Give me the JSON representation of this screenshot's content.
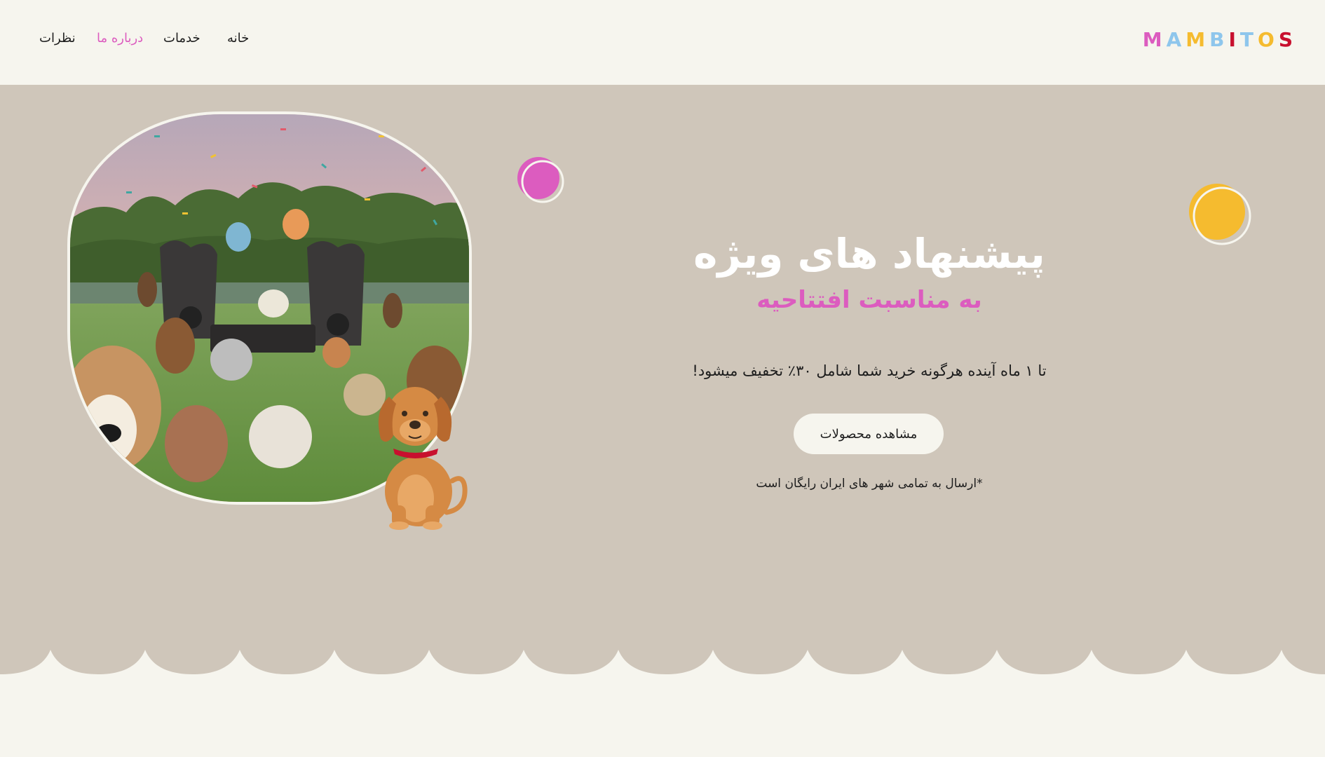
{
  "nav": {
    "items": [
      {
        "label": "نظرات",
        "active": false
      },
      {
        "label": "درباره ما",
        "active": true
      },
      {
        "label": "خدمات",
        "active": false
      },
      {
        "label": "خانه",
        "active": false
      }
    ]
  },
  "logo": {
    "letters": [
      {
        "char": "M",
        "color": "#dc5cbf"
      },
      {
        "char": "A",
        "color": "#8ec6ec"
      },
      {
        "char": "M",
        "color": "#f5bb2f"
      },
      {
        "char": "B",
        "color": "#8ec6ec"
      },
      {
        "char": "I",
        "color": "#c8102e"
      },
      {
        "char": "T",
        "color": "#8ec6ec"
      },
      {
        "char": "O",
        "color": "#f5bb2f"
      },
      {
        "char": "S",
        "color": "#c8102e"
      }
    ]
  },
  "hero": {
    "title": "پیشنهاد های ویژه",
    "subtitle": "به مناسبت افتتاحیه",
    "description": "تا ۱ ماه آینده هرگونه خرید شما شامل ۳۰٪ تخفیف میشود!",
    "cta_label": "مشاهده محصولات",
    "note": "*ارسال به تمامی شهر های ایران رایگان است"
  },
  "colors": {
    "background": "#f6f5ee",
    "hero_background": "#cfc6ba",
    "accent_pink": "#dc5cbf",
    "accent_yellow": "#f5bb2f"
  },
  "icons": {
    "hero_image": "dog-party-photo",
    "mascot": "cartoon-dog-icon",
    "pink_circle": "decorative-circle",
    "yellow_circle": "decorative-circle"
  }
}
